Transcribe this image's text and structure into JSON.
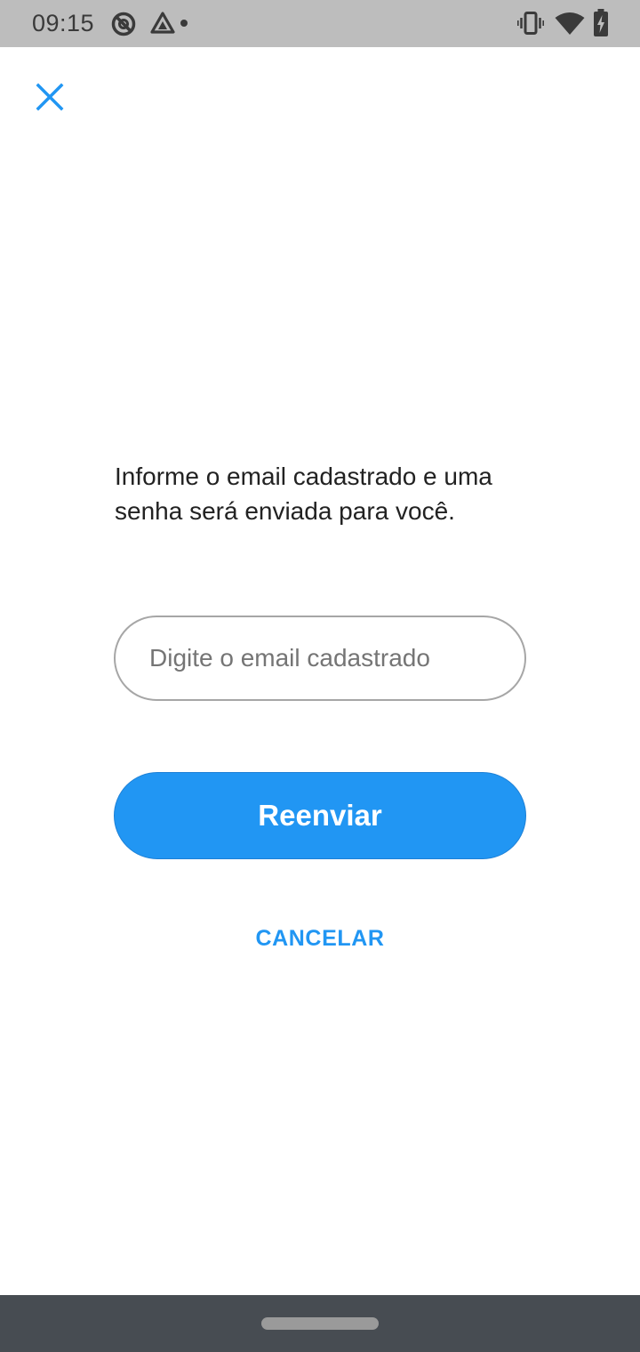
{
  "status_bar": {
    "time": "09:15",
    "icons": [
      "sync-icon",
      "drive-icon",
      "notification-dot-icon",
      "vibrate-icon",
      "wifi-icon",
      "battery-charging-icon"
    ]
  },
  "header": {
    "close_icon": "close-icon"
  },
  "form": {
    "instructions": "Informe o email cadastrado e uma senha será enviada para você.",
    "email": {
      "value": "",
      "placeholder": "Digite o email cadastrado"
    },
    "resend_label": "Reenviar",
    "cancel_label": "CANCELAR"
  },
  "colors": {
    "accent": "#2196f3",
    "status_bar": "#bdbdbd",
    "nav_bar": "#474c52"
  }
}
